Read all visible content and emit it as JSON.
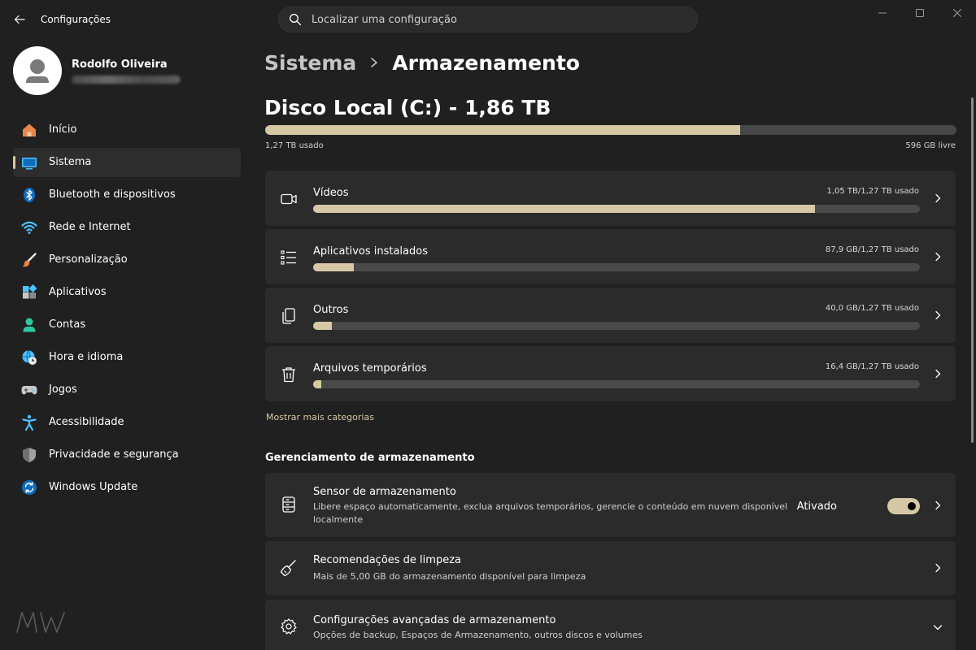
{
  "window": {
    "app_title": "Configurações",
    "search_placeholder": "Localizar uma configuração"
  },
  "profile": {
    "name": "Rodolfo Oliveira"
  },
  "sidebar": {
    "items": [
      {
        "label": "Início",
        "icon": "home-icon",
        "active": false
      },
      {
        "label": "Sistema",
        "icon": "monitor-icon",
        "active": true
      },
      {
        "label": "Bluetooth e dispositivos",
        "icon": "bluetooth-icon",
        "active": false
      },
      {
        "label": "Rede e Internet",
        "icon": "wifi-icon",
        "active": false
      },
      {
        "label": "Personalização",
        "icon": "brush-icon",
        "active": false
      },
      {
        "label": "Aplicativos",
        "icon": "apps-icon",
        "active": false
      },
      {
        "label": "Contas",
        "icon": "person-icon",
        "active": false
      },
      {
        "label": "Hora e idioma",
        "icon": "globe-clock-icon",
        "active": false
      },
      {
        "label": "Jogos",
        "icon": "gamepad-icon",
        "active": false
      },
      {
        "label": "Acessibilidade",
        "icon": "accessibility-icon",
        "active": false
      },
      {
        "label": "Privacidade e segurança",
        "icon": "shield-icon",
        "active": false
      },
      {
        "label": "Windows Update",
        "icon": "update-icon",
        "active": false
      }
    ]
  },
  "breadcrumb": {
    "parent": "Sistema",
    "current": "Armazenamento"
  },
  "disk": {
    "title": "Disco Local (C:) - 1,86 TB",
    "used_label": "1,27 TB usado",
    "free_label": "596 GB livre",
    "used_fraction": 0.687
  },
  "categories": [
    {
      "label": "Vídeos",
      "usage": "1,05 TB/1,27 TB usado",
      "fraction": 0.827,
      "icon": "video-icon"
    },
    {
      "label": "Aplicativos instalados",
      "usage": "87,9 GB/1,27 TB usado",
      "fraction": 0.067,
      "icon": "app-list-icon"
    },
    {
      "label": "Outros",
      "usage": "40,0 GB/1,27 TB usado",
      "fraction": 0.031,
      "icon": "documents-icon"
    },
    {
      "label": "Arquivos temporários",
      "usage": "16,4 GB/1,27 TB usado",
      "fraction": 0.013,
      "icon": "trash-icon"
    }
  ],
  "show_more": "Mostrar mais categorias",
  "management": {
    "title": "Gerenciamento de armazenamento",
    "sensor": {
      "title": "Sensor de armazenamento",
      "desc": "Libere espaço automaticamente, exclua arquivos temporários, gerencie o conteúdo em nuvem disponível localmente",
      "toggle_label": "Ativado",
      "toggle_on": true
    },
    "cleanup": {
      "title": "Recomendações de limpeza",
      "desc": "Mais de 5,00 GB do armazenamento disponível para limpeza"
    },
    "advanced": {
      "title": "Configurações avançadas de armazenamento",
      "desc": "Opções de backup, Espaços de Armazenamento, outros discos e volumes"
    }
  },
  "colors": {
    "accent": "#d7c8a5",
    "background": "#202020",
    "card": "#2b2b2b",
    "bar_track": "#4a4a4a"
  }
}
